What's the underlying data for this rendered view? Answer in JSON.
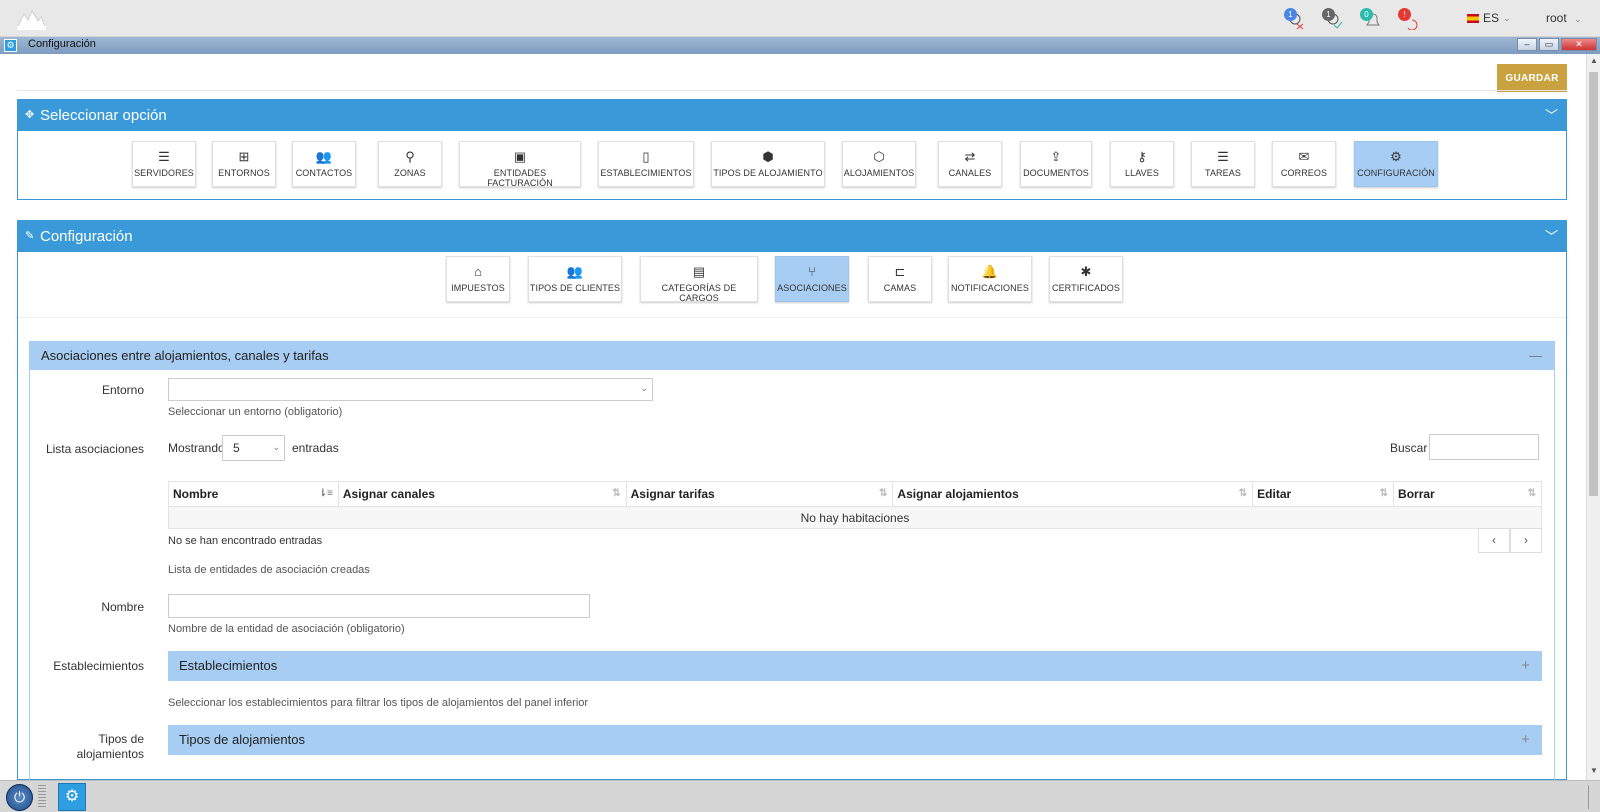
{
  "topbar": {
    "language": "ES",
    "user": "root",
    "badges": [
      {
        "count": "1",
        "color": "#4a86e8",
        "icon": "user-x-icon"
      },
      {
        "count": "1",
        "color": "#666666",
        "icon": "user-check-icon"
      },
      {
        "count": "0",
        "color": "#2bbbad",
        "icon": "bell-icon"
      },
      {
        "count": "!",
        "color": "#e53935",
        "icon": "alert-icon"
      }
    ]
  },
  "window": {
    "title": "Configuración"
  },
  "toolbar": {
    "save_label": "GUARDAR"
  },
  "panel_select": {
    "title": "Seleccionar opción",
    "tiles": [
      {
        "label": "SERVIDORES",
        "icon": "server-icon",
        "glyph": "☰"
      },
      {
        "label": "ENTORNOS",
        "icon": "sitemap-icon",
        "glyph": "⊞"
      },
      {
        "label": "CONTACTOS",
        "icon": "users-icon",
        "glyph": "👥"
      },
      {
        "label": "ZONAS",
        "icon": "map-marker-icon",
        "glyph": "⚲"
      },
      {
        "label": "ENTIDADES FACTURACIÓN",
        "icon": "money-icon",
        "glyph": "▣"
      },
      {
        "label": "ESTABLECIMIENTOS",
        "icon": "building-icon",
        "glyph": "▯"
      },
      {
        "label": "TIPOS DE ALOJAMIENTO",
        "icon": "cubes-icon",
        "glyph": "⬢"
      },
      {
        "label": "ALOJAMIENTOS",
        "icon": "cube-icon",
        "glyph": "⬡"
      },
      {
        "label": "CANALES",
        "icon": "exchange-icon",
        "glyph": "⇄"
      },
      {
        "label": "DOCUMENTOS",
        "icon": "upload-icon",
        "glyph": "⇪"
      },
      {
        "label": "LLAVES",
        "icon": "key-icon",
        "glyph": "⚷"
      },
      {
        "label": "TAREAS",
        "icon": "tasks-icon",
        "glyph": "☰"
      },
      {
        "label": "CORREOS",
        "icon": "envelope-icon",
        "glyph": "✉"
      },
      {
        "label": "CONFIGURACIÓN",
        "icon": "cogs-icon",
        "glyph": "⚙"
      }
    ]
  },
  "panel_config": {
    "title": "Configuración",
    "tiles": [
      {
        "label": "IMPUESTOS",
        "icon": "bank-icon",
        "glyph": "⌂"
      },
      {
        "label": "TIPOS DE CLIENTES",
        "icon": "users-icon",
        "glyph": "👥"
      },
      {
        "label": "CATEGORÍAS DE CARGOS",
        "icon": "archive-icon",
        "glyph": "▤"
      },
      {
        "label": "ASOCIACIONES",
        "icon": "code-fork-icon",
        "glyph": "⑂"
      },
      {
        "label": "CAMAS",
        "icon": "bed-icon",
        "glyph": "⊏"
      },
      {
        "label": "NOTIFICACIONES",
        "icon": "bell-icon",
        "glyph": "🔔"
      },
      {
        "label": "CERTIFICADOS",
        "icon": "asterisk-icon",
        "glyph": "✱"
      }
    ]
  },
  "associations": {
    "title": "Asociaciones entre alojamientos, canales y tarifas",
    "entorno_label": "Entorno",
    "entorno_help": "Seleccionar un entorno (obligatorio)",
    "lista_label": "Lista asociaciones",
    "showing_prefix": "Mostrando",
    "page_size": "5",
    "showing_suffix": "entradas",
    "search_label": "Buscar",
    "columns": [
      "Nombre",
      "Asignar canales",
      "Asignar tarifas",
      "Asignar alojamientos",
      "Editar",
      "Borrar"
    ],
    "empty_text": "No hay habitaciones",
    "info_text": "No se han encontrado entradas",
    "pager_prev": "‹",
    "pager_next": "›",
    "list_help": "Lista de entidades de asociación creadas",
    "nombre_label": "Nombre",
    "nombre_help": "Nombre de la entidad de asociación (obligatorio)",
    "estab_label": "Establecimientos",
    "estab_bar": "Establecimientos",
    "estab_help": "Seleccionar los establecimientos para filtrar los tipos de alojamientos del panel inferior",
    "tipos_label": "Tipos de alojamientos",
    "tipos_bar": "Tipos de alojamientos"
  }
}
